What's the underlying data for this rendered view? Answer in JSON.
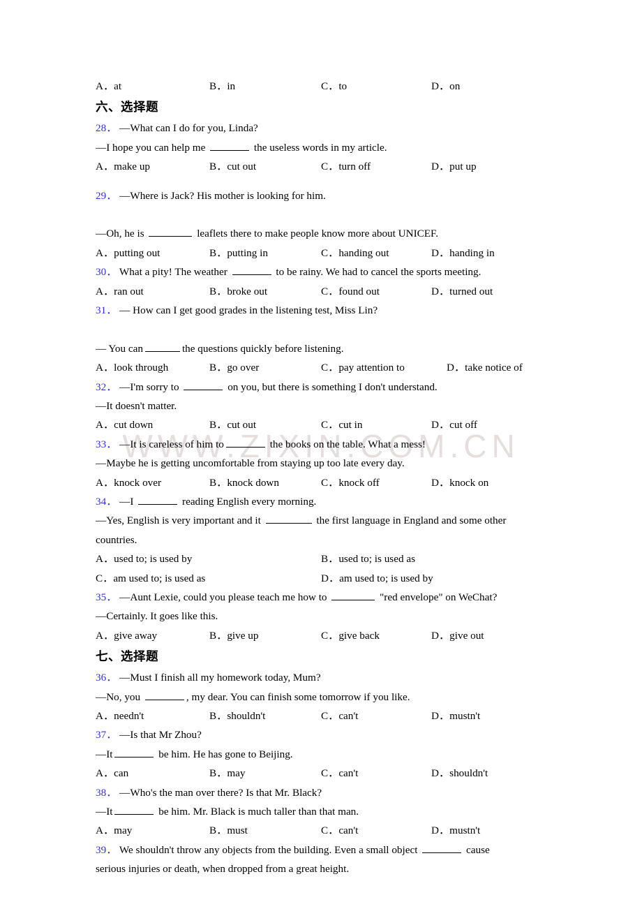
{
  "watermark": {
    "text": "WWW.ZIXIN.COM.CN"
  },
  "colors": {
    "question_number": "#3333dd",
    "text": "#000000",
    "watermark": "#e6dede"
  },
  "top_orphan_options": {
    "label": "orphan-options-row",
    "options": [
      "A．at",
      "B．in",
      "C．to",
      "D．on"
    ]
  },
  "sections": [
    {
      "heading": "六、选择题",
      "questions": [
        {
          "number": "28．",
          "stem_lines": [
            "—What can I do for you, Linda?",
            "—I hope you can help me ____ the useless words in my article."
          ],
          "stem_part_a": "—I hope you can help me ",
          "stem_part_b": " the useless words in my article.",
          "options": [
            "A．make up",
            "B．cut out",
            "C．turn off",
            "D．put up"
          ]
        },
        {
          "number": "29．",
          "stem_lines": [
            "—Where is Jack? His mother is looking for him.",
            "—Oh, he is ____ leaflets there to make people know more about UNICEF."
          ],
          "stem_part_a": "—Oh, he is ",
          "stem_part_b": " leaflets there to make people know more about UNICEF.",
          "options": [
            "A．putting out",
            "B．putting in",
            "C．handing out",
            "D．handing in"
          ]
        },
        {
          "number": "30．",
          "stem_part_a": "What a pity! The weather ",
          "stem_part_b": " to be rainy. We had to cancel the sports meeting.",
          "options": [
            "A．ran out",
            "B．broke out",
            "C．found out",
            "D．turned out"
          ]
        },
        {
          "number": "31．",
          "stem_lines": [
            "— How can I get good grades in the listening test, Miss Lin?",
            "— You can____the questions quickly before listening."
          ],
          "stem_part_a": "— You can",
          "stem_part_b": "the questions quickly before listening.",
          "options": [
            "A．look through",
            "B．go over",
            "C．pay attention to",
            "D．take notice of"
          ]
        },
        {
          "number": "32．",
          "stem_part_a": "—I'm sorry to ",
          "stem_part_b": " on you, but there is something I don't understand.",
          "stem_line2": "—It doesn't matter.",
          "options": [
            "A．cut down",
            "B．cut out",
            "C．cut in",
            "D．cut off"
          ]
        },
        {
          "number": "33．",
          "stem_part_a": "—It is careless of him to",
          "stem_part_b": " the books on the table. What a mess!",
          "stem_line2": "—Maybe he is getting uncomfortable from staying up too late every day.",
          "options": [
            "A．knock over",
            "B．knock down",
            "C．knock off",
            "D．knock on"
          ]
        },
        {
          "number": "34．",
          "stem_part_a": "—I ",
          "stem_part_b": " reading English every morning.",
          "stem_line2_a": "—Yes, English is very important and it ",
          "stem_line2_b": " the first language in England and some other",
          "stem_line3": "countries.",
          "options": [
            "A．used to; is used by",
            "B．used to; is used as",
            "C．am used to; is used as",
            "D．am used to; is used by"
          ]
        },
        {
          "number": "35．",
          "stem_part_a": "—Aunt Lexie, could you please teach me how to ",
          "stem_part_b": " \"red envelope\" on WeChat?",
          "stem_line2": "—Certainly. It goes like this.",
          "options": [
            "A．give away",
            "B．give up",
            "C．give back",
            "D．give out"
          ]
        }
      ]
    },
    {
      "heading": "七、选择题",
      "questions": [
        {
          "number": "36．",
          "stem_lines": [
            "—Must I finish all my homework today, Mum?"
          ],
          "stem_part_a": "—No, you ",
          "stem_part_b": ", my dear. You can finish some tomorrow if you like.",
          "options": [
            "A．needn't",
            "B．shouldn't",
            "C．can't",
            "D．mustn't"
          ]
        },
        {
          "number": "37．",
          "stem_lines": [
            "—Is that Mr Zhou?"
          ],
          "stem_part_a": "—It",
          "stem_part_b": " be him. He has gone to Beijing.",
          "options": [
            "A．can",
            "B．may",
            "C．can't",
            "D．shouldn't"
          ]
        },
        {
          "number": "38．",
          "stem_lines": [
            "—Who's the man over there? Is that Mr. Black?"
          ],
          "stem_part_a": "—It",
          "stem_part_b": " be him. Mr. Black is much taller than that man.",
          "options": [
            "A．may",
            "B．must",
            "C．can't",
            "D．mustn't"
          ]
        },
        {
          "number": "39．",
          "stem_part_a": "We shouldn't throw any objects from the building. Even a small object ",
          "stem_part_b": " cause",
          "stem_line2": "serious injuries or death, when dropped from a great height."
        }
      ]
    }
  ]
}
